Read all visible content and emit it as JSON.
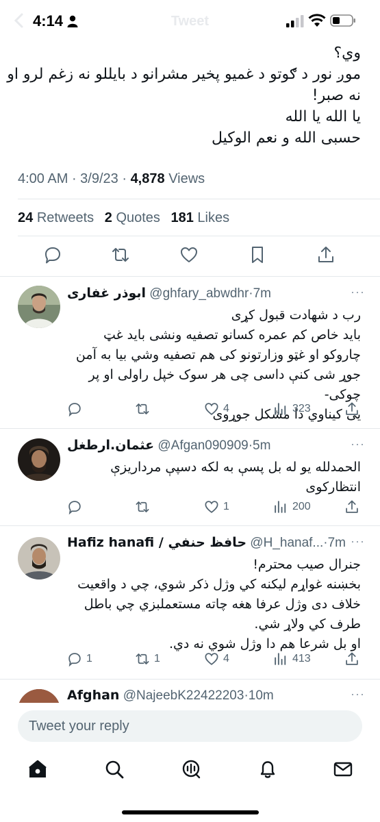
{
  "status_bar": {
    "time": "4:14"
  },
  "nav": {
    "title": "Tweet"
  },
  "tweet": {
    "lines": [
      "وي؟",
      "موږ نور د ګوتو د غمیو پخیر مشرانو د بایللو نه زغم لرو او",
      "نه صبر!",
      "یا الله یا الله",
      "حسبی الله و نعم الوکیل"
    ],
    "time": "4:00 AM",
    "date": "3/9/23",
    "views_count": "4,878",
    "views_label": "Views",
    "retweets_count": "24",
    "retweets_label": "Retweets",
    "quotes_count": "2",
    "quotes_label": "Quotes",
    "likes_count": "181",
    "likes_label": "Likes"
  },
  "replies": [
    {
      "name": "ابوذر غفاری",
      "handle": "@ghfary_abwdhr",
      "age": "7m",
      "lines": [
        "رب د شهادت قبول کړی",
        "باید خاص کم عمره کسانو تصفیه ونشی باید غټ",
        "چاروکو او غټو وزارتونو کی هم تصفیه وشي بیا به آمن",
        "جوړ شی کنې داسی چی هر سوک خپل راولی او پر چوکی-",
        "یی کیناوي دا مشکل جوړوی"
      ],
      "replies": "",
      "retweets": "",
      "likes": "4",
      "views": "323"
    },
    {
      "name": "عثمان.ارطغل",
      "handle": "@Afgan090909",
      "age": "5m",
      "lines": [
        "الحمدلله یو له بل پسې به لکه دسپې مرداریزې",
        "انتظارکوی"
      ],
      "replies": "",
      "retweets": "",
      "likes": "1",
      "views": "200"
    },
    {
      "name": "Hafiz hanafi / حافظ حنفي",
      "handle": "@H_hanaf...",
      "age": "7m",
      "lines": [
        "جنرال صیب محترم!",
        "بخښنه غواړم لیکنه کي وژل ذکر شوي، چي د واقعیت",
        "خلاف دی وژل عرفا هغه چاته مستعملبزي چي باطل",
        "طرف کي ولاړ شي.",
        "او بل شرعا هم دا وژل شوي نه دي."
      ],
      "replies": "1",
      "retweets": "1",
      "likes": "4",
      "views": "413"
    },
    {
      "name": "Afghan",
      "handle": "@NajeebK22422203",
      "age": "10m"
    }
  ],
  "compose": {
    "placeholder": "Tweet your reply"
  },
  "colors": {
    "text": "#0f1419",
    "secondary": "#536471",
    "divider": "#e4e8eb",
    "compose_bg": "#eff3f4"
  },
  "icons": [
    "chevron-back-icon",
    "person-icon",
    "signal-icon",
    "wifi-icon",
    "battery-icon",
    "reply-icon",
    "retweet-icon",
    "like-icon",
    "bookmark-icon",
    "share-icon",
    "views-icon",
    "home-icon",
    "search-icon",
    "spaces-icon",
    "notifications-icon",
    "messages-icon"
  ]
}
